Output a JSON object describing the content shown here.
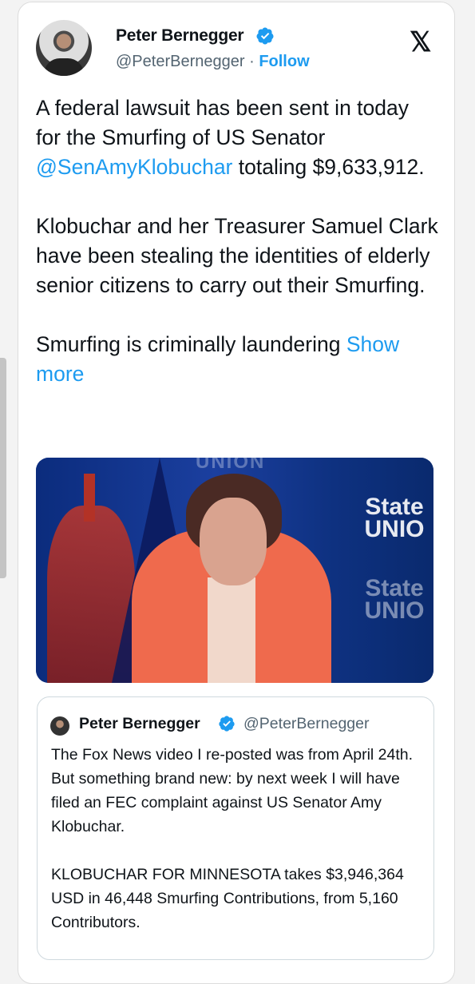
{
  "tweet": {
    "author_name": "Peter Bernegger",
    "handle": "@PeterBernegger",
    "separator": "·",
    "follow_label": "Follow",
    "platform_logo": "𝕏",
    "body": {
      "p1_a": "A federal lawsuit has been sent in today for the Smurfing of US Senator ",
      "mention": "@SenAmyKlobuchar",
      "p1_b": " totaling $9,633,912.",
      "p2": "Klobuchar and her Treasurer Samuel Clark have been stealing the identities of elderly senior citizens to carry out their Smurfing.",
      "p3": "Smurfing is criminally laundering ",
      "show_more": "Show more"
    },
    "media": {
      "logo_text_1": "State UNIO",
      "logo_text_2": "State UNIO",
      "logo_text_3": "UNION"
    }
  },
  "quote": {
    "author_name": "Peter Bernegger",
    "handle": "@PeterBernegger",
    "p1": "The Fox News video I re-posted was from April 24th.  But something brand new: by next week I will have filed an FEC complaint against US Senator Amy Klobuchar.",
    "p2": "KLOBUCHAR FOR MINNESOTA takes $3,946,364 USD in 46,448 Smurfing Contributions, from 5,160 Contributors."
  },
  "colors": {
    "accent": "#1d9bf0",
    "text": "#0f1419",
    "muted": "#536471"
  },
  "icons": [
    "verified-badge-icon",
    "x-logo-icon"
  ]
}
